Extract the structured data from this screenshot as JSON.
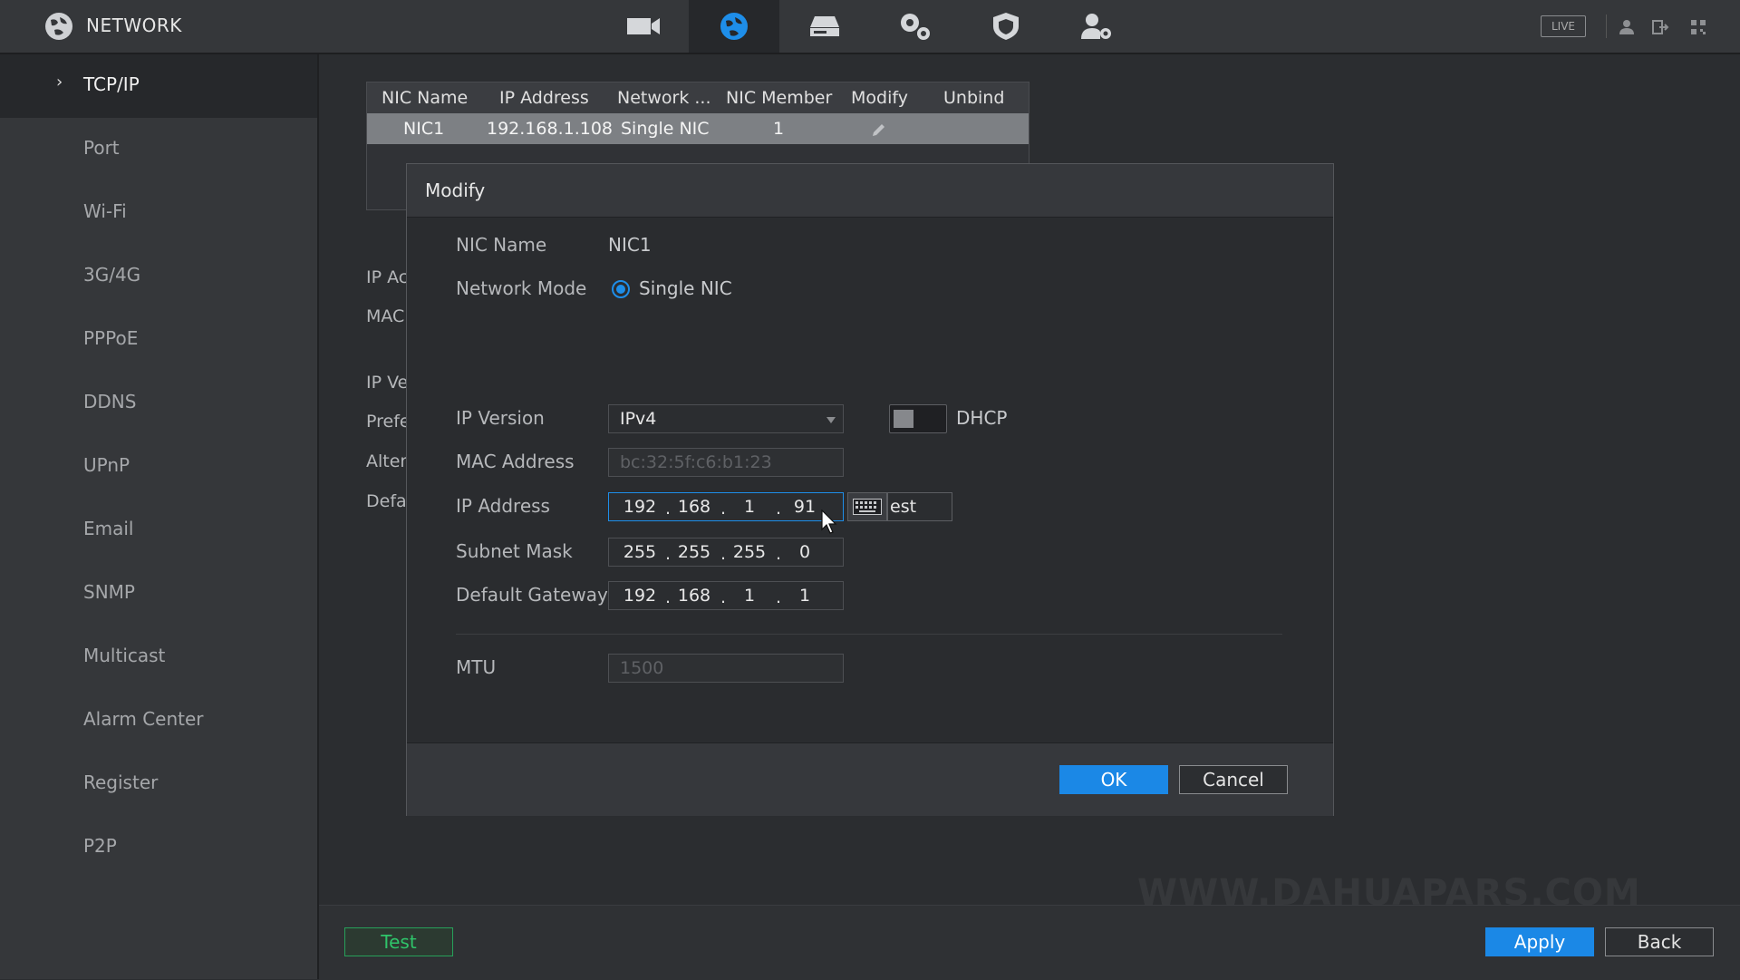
{
  "header": {
    "app_title": "NETWORK",
    "nav_icons": [
      "camera-icon",
      "network-globe-icon",
      "storage-icon",
      "system-gears-icon",
      "security-shield-icon",
      "account-icon"
    ],
    "active_nav": "network-globe-icon",
    "live_label": "LIVE",
    "right_icons": [
      "user-icon",
      "logout-icon",
      "qr-code-icon"
    ]
  },
  "sidebar": {
    "items": [
      {
        "label": "TCP/IP",
        "active": true
      },
      {
        "label": "Port"
      },
      {
        "label": "Wi-Fi"
      },
      {
        "label": "3G/4G"
      },
      {
        "label": "PPPoE"
      },
      {
        "label": "DDNS"
      },
      {
        "label": "UPnP"
      },
      {
        "label": "Email"
      },
      {
        "label": "SNMP"
      },
      {
        "label": "Multicast"
      },
      {
        "label": "Alarm Center"
      },
      {
        "label": "Register"
      },
      {
        "label": "P2P"
      }
    ]
  },
  "nic_table": {
    "columns": [
      "NIC Name",
      "IP Address",
      "Network ...",
      "NIC Member",
      "Modify",
      "Unbind"
    ],
    "rows": [
      {
        "nic_name": "NIC1",
        "ip_address": "192.168.1.108",
        "network_mode": "Single NIC",
        "nic_member": "1"
      }
    ]
  },
  "background_labels": [
    "IP Ac",
    "MAC",
    "IP Ve",
    "Prefe",
    "Alter",
    "Defa"
  ],
  "watermark": "WWW.DAHUAPARS.COM",
  "bottom": {
    "test_label": "Test",
    "apply_label": "Apply",
    "back_label": "Back"
  },
  "modal": {
    "title": "Modify",
    "nic_name_label": "NIC Name",
    "nic_name_value": "NIC1",
    "network_mode_label": "Network Mode",
    "network_mode_option": "Single NIC",
    "ip_version_label": "IP Version",
    "ip_version_value": "IPv4",
    "dhcp_label": "DHCP",
    "dhcp_enabled": false,
    "mac_label": "MAC Address",
    "mac_value": "bc:32:5f:c6:b1:23",
    "ip_label": "IP Address",
    "ip_octets": [
      "192",
      "168",
      "1",
      "91"
    ],
    "ip_test_label": "est",
    "subnet_label": "Subnet Mask",
    "subnet_octets": [
      "255",
      "255",
      "255",
      "0"
    ],
    "gateway_label": "Default Gateway",
    "gateway_octets": [
      "192",
      "168",
      "1",
      "1"
    ],
    "mtu_label": "MTU",
    "mtu_value": "1500",
    "ok_label": "OK",
    "cancel_label": "Cancel"
  },
  "colors": {
    "accent": "#1b88e6",
    "green": "#2fc46a"
  }
}
